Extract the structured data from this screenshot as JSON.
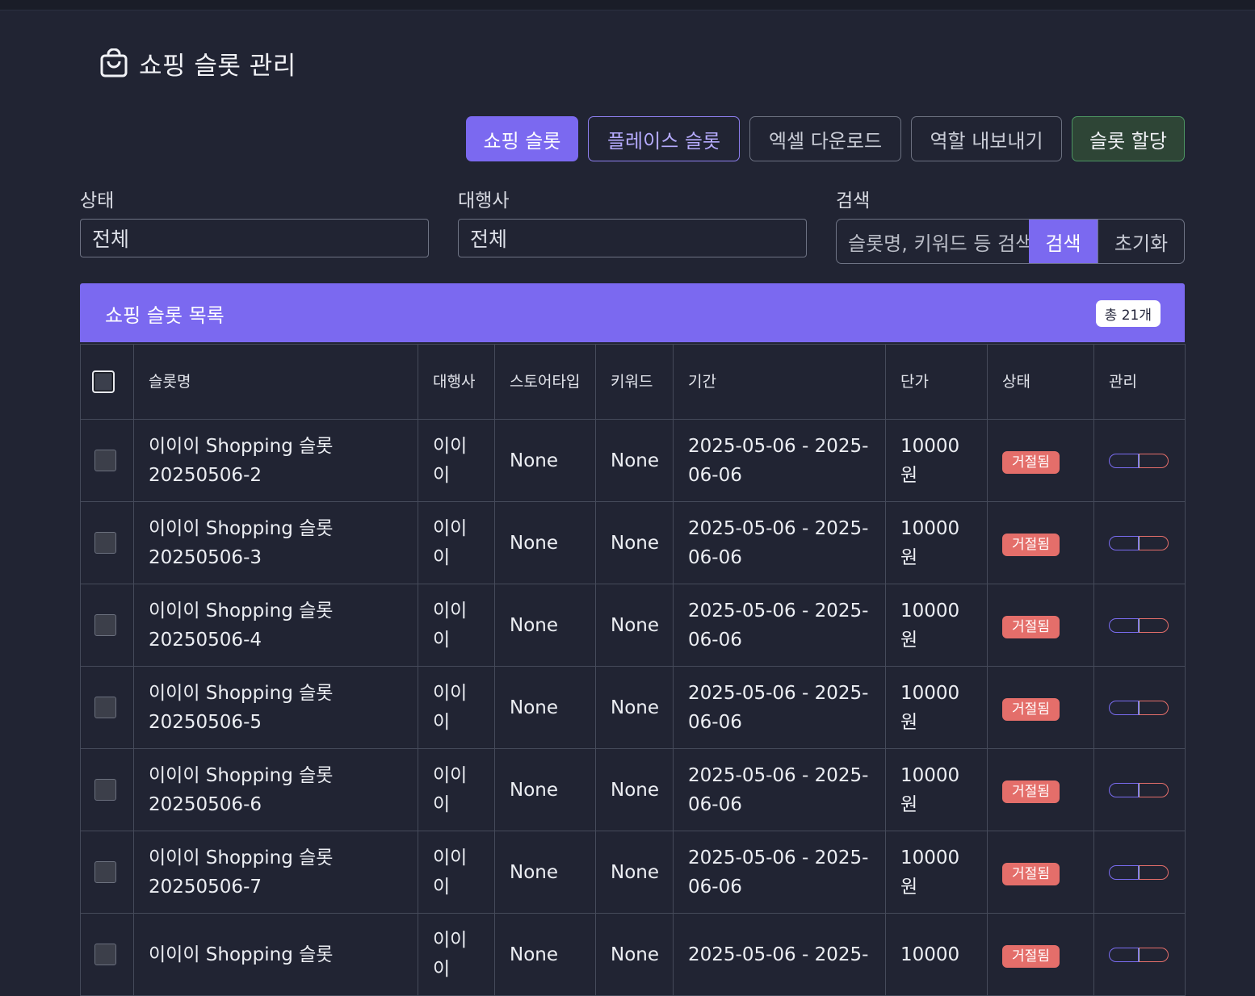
{
  "page": {
    "title": "쇼핑 슬롯 관리"
  },
  "toolbar": {
    "shopping_slot": "쇼핑 슬롯",
    "place_slot": "플레이스 슬롯",
    "excel_download": "엑셀 다운로드",
    "role_export": "역할 내보내기",
    "slot_assign": "슬롯 할당"
  },
  "filters": {
    "status_label": "상태",
    "status_value": "전체",
    "agency_label": "대행사",
    "agency_value": "전체",
    "search_label": "검색",
    "search_placeholder": "슬롯명, 키워드 등 검색",
    "search_button": "검색",
    "reset_button": "초기화"
  },
  "list": {
    "title": "쇼핑 슬롯 목록",
    "count_label": "총 21개",
    "columns": [
      "슬롯명",
      "대행사",
      "스토어타입",
      "키워드",
      "기간",
      "단가",
      "상태",
      "관리"
    ],
    "rows": [
      {
        "name": "이이이 Shopping 슬롯 20250506-2",
        "agency": "이이이",
        "store_type": "None",
        "keyword": "None",
        "period": "2025-05-06 - 2025-06-06",
        "price": "10000원",
        "status": "거절됨"
      },
      {
        "name": "이이이 Shopping 슬롯 20250506-3",
        "agency": "이이이",
        "store_type": "None",
        "keyword": "None",
        "period": "2025-05-06 - 2025-06-06",
        "price": "10000원",
        "status": "거절됨"
      },
      {
        "name": "이이이 Shopping 슬롯 20250506-4",
        "agency": "이이이",
        "store_type": "None",
        "keyword": "None",
        "period": "2025-05-06 - 2025-06-06",
        "price": "10000원",
        "status": "거절됨"
      },
      {
        "name": "이이이 Shopping 슬롯 20250506-5",
        "agency": "이이이",
        "store_type": "None",
        "keyword": "None",
        "period": "2025-05-06 - 2025-06-06",
        "price": "10000원",
        "status": "거절됨"
      },
      {
        "name": "이이이 Shopping 슬롯 20250506-6",
        "agency": "이이이",
        "store_type": "None",
        "keyword": "None",
        "period": "2025-05-06 - 2025-06-06",
        "price": "10000원",
        "status": "거절됨"
      },
      {
        "name": "이이이 Shopping 슬롯 20250506-7",
        "agency": "이이이",
        "store_type": "None",
        "keyword": "None",
        "period": "2025-05-06 - 2025-06-06",
        "price": "10000원",
        "status": "거절됨"
      },
      {
        "name": "이이이 Shopping 슬롯",
        "agency": "이이이",
        "store_type": "None",
        "keyword": "None",
        "period": "2025-05-06 - 2025-",
        "price": "10000",
        "status": "거절됨"
      }
    ]
  },
  "colors": {
    "background": "#212433",
    "accent": "#7b69f0",
    "danger": "#e46e6a",
    "success_border": "#4c9461"
  },
  "icons": {
    "title_icon": "shopping-bag-icon"
  }
}
